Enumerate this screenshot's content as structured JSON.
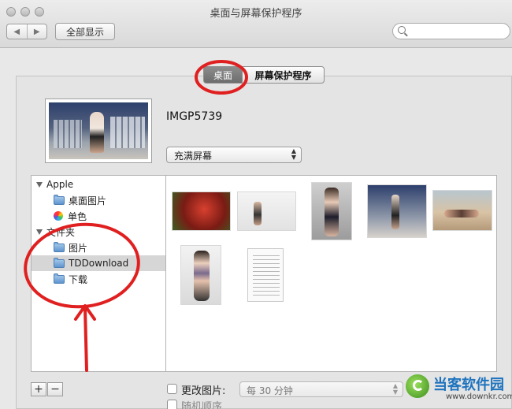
{
  "window": {
    "title": "桌面与屏幕保护程序"
  },
  "toolbar": {
    "back": "◀",
    "forward": "▶",
    "show_all": "全部显示",
    "search_placeholder": ""
  },
  "tabs": [
    {
      "label": "桌面",
      "selected": true
    },
    {
      "label": "屏幕保护程序",
      "selected": false
    }
  ],
  "preview": {
    "filename": "IMGP5739",
    "fit_mode": "充满屏幕"
  },
  "sidebar": {
    "groups": [
      {
        "label": "Apple",
        "items": [
          {
            "label": "桌面图片",
            "icon": "folder-icon"
          },
          {
            "label": "单色",
            "icon": "color-wheel-icon"
          }
        ]
      },
      {
        "label": "文件夹",
        "items": [
          {
            "label": "图片",
            "icon": "folder-icon"
          },
          {
            "label": "TDDownload",
            "icon": "folder-icon",
            "selected": true
          },
          {
            "label": "下载",
            "icon": "folder-icon"
          }
        ]
      }
    ]
  },
  "bottom": {
    "add": "+",
    "remove": "−",
    "change_picture": "更改图片:",
    "interval": "每 30 分钟",
    "random_order": "随机顺序"
  },
  "watermark": {
    "title": "当客软件园",
    "url": "www.downkr.com"
  },
  "colors": {
    "annotation": "#e02020",
    "tab_selected": "#7a7a7a"
  }
}
